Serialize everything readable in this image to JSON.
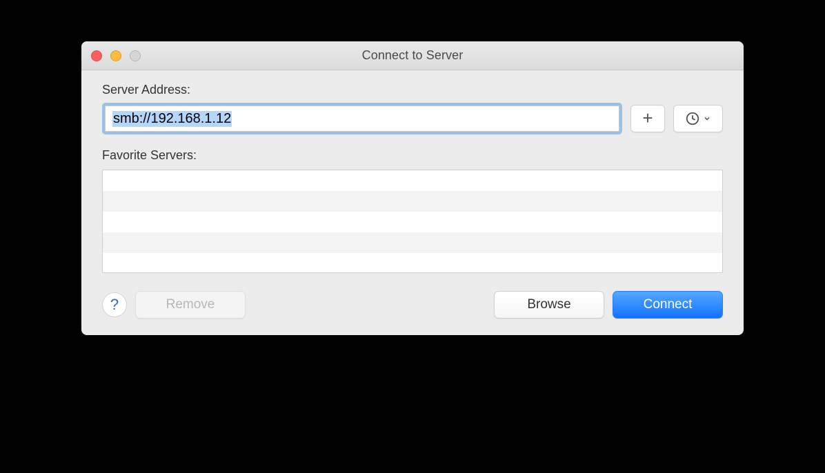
{
  "window": {
    "title": "Connect to Server"
  },
  "labels": {
    "server_address": "Server Address:",
    "favorite_servers": "Favorite Servers:"
  },
  "address": {
    "value": "smb://192.168.1.12"
  },
  "buttons": {
    "remove": "Remove",
    "browse": "Browse",
    "connect": "Connect",
    "help": "?"
  },
  "icons": {
    "add": "plus-icon",
    "history": "clock-icon",
    "history_chevron": "chevron-down-icon"
  },
  "favorites": []
}
